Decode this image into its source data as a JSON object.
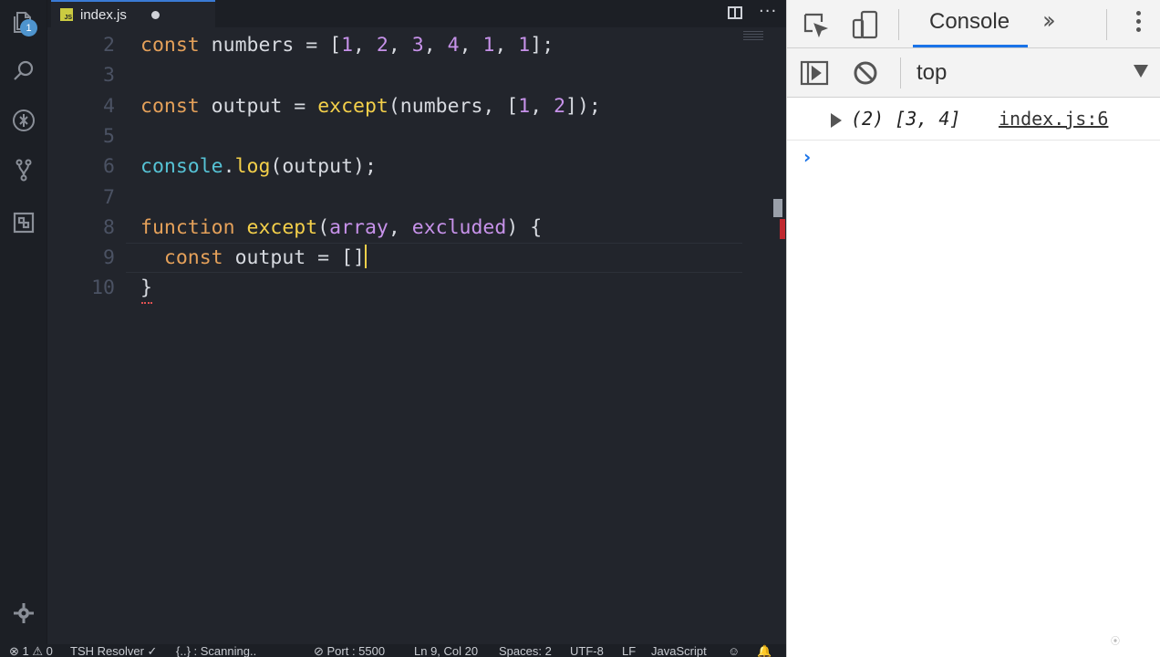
{
  "editor": {
    "tab": {
      "label": "index.js",
      "file_icon": "js-file-icon"
    },
    "activity_badge": "1",
    "lines": [
      {
        "num": "2",
        "tokens": [
          {
            "t": "const",
            "c": "kw"
          },
          {
            "t": " numbers = [",
            "c": ""
          },
          {
            "t": "1",
            "c": "num"
          },
          {
            "t": ", ",
            "c": ""
          },
          {
            "t": "2",
            "c": "num"
          },
          {
            "t": ", ",
            "c": ""
          },
          {
            "t": "3",
            "c": "num"
          },
          {
            "t": ", ",
            "c": ""
          },
          {
            "t": "4",
            "c": "num"
          },
          {
            "t": ", ",
            "c": ""
          },
          {
            "t": "1",
            "c": "num"
          },
          {
            "t": ", ",
            "c": ""
          },
          {
            "t": "1",
            "c": "num"
          },
          {
            "t": "];",
            "c": ""
          }
        ]
      },
      {
        "num": "3",
        "tokens": []
      },
      {
        "num": "4",
        "tokens": [
          {
            "t": "const",
            "c": "kw"
          },
          {
            "t": " output = ",
            "c": ""
          },
          {
            "t": "except",
            "c": "fn"
          },
          {
            "t": "(numbers, [",
            "c": ""
          },
          {
            "t": "1",
            "c": "num"
          },
          {
            "t": ", ",
            "c": ""
          },
          {
            "t": "2",
            "c": "num"
          },
          {
            "t": "]);",
            "c": ""
          }
        ]
      },
      {
        "num": "5",
        "tokens": []
      },
      {
        "num": "6",
        "tokens": [
          {
            "t": "console",
            "c": "builtin"
          },
          {
            "t": ".",
            "c": ""
          },
          {
            "t": "log",
            "c": "method"
          },
          {
            "t": "(output);",
            "c": ""
          }
        ]
      },
      {
        "num": "7",
        "tokens": []
      },
      {
        "num": "8",
        "tokens": [
          {
            "t": "function",
            "c": "kw"
          },
          {
            "t": " ",
            "c": ""
          },
          {
            "t": "except",
            "c": "fn"
          },
          {
            "t": "(",
            "c": ""
          },
          {
            "t": "array",
            "c": "param"
          },
          {
            "t": ", ",
            "c": ""
          },
          {
            "t": "excluded",
            "c": "param"
          },
          {
            "t": ") {",
            "c": ""
          }
        ]
      },
      {
        "num": "9",
        "current": true,
        "tokens": [
          {
            "t": "  ",
            "c": ""
          },
          {
            "t": "const",
            "c": "kw"
          },
          {
            "t": " output = []",
            "c": ""
          }
        ]
      },
      {
        "num": "10",
        "tokens": [
          {
            "t": "}",
            "c": ""
          }
        ]
      }
    ],
    "colors": {
      "background": "#22252c",
      "keyword": "#e5a15a",
      "number": "#c792ea",
      "function": "#f4d04a",
      "builtin": "#56c3d6"
    }
  },
  "statusbar": {
    "problems": "⊗ 1 ⚠ 0",
    "resolver": "TSH Resolver ✓",
    "scanning": "{..} : Scanning..",
    "port": "⊘ Port : 5500",
    "position": "Ln 9, Col 20",
    "spaces": "Spaces: 2",
    "encoding": "UTF-8",
    "eol": "LF",
    "language": "JavaScript"
  },
  "devtools": {
    "active_tab": "Console",
    "context": "top",
    "console_entries": [
      {
        "value": "(2) [3, 4]",
        "source": "index.js:6"
      }
    ],
    "prompt_symbol": "›",
    "accent": "#1a73e8"
  }
}
